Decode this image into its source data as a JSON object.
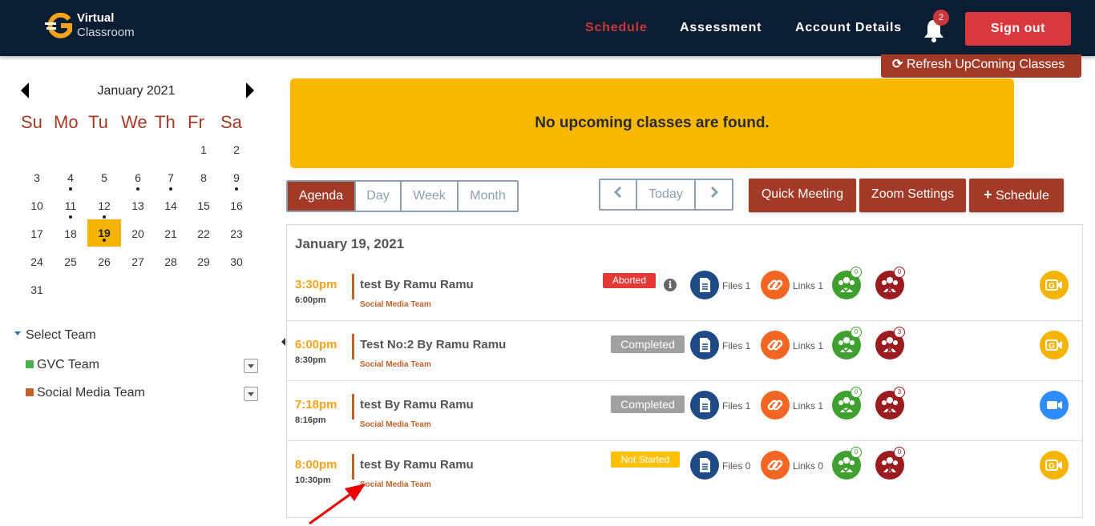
{
  "header": {
    "logo_line1": "Virtual",
    "logo_line2": "Classroom",
    "nav": [
      {
        "label": "Schedule",
        "active": true
      },
      {
        "label": "Assessment",
        "active": false
      },
      {
        "label": "Account Details",
        "active": false
      }
    ],
    "notification_count": "2",
    "signout_label": "Sign out"
  },
  "refresh_label": "Refresh UpComing Classes",
  "calendar": {
    "title": "January 2021",
    "weekdays": [
      "Su",
      "Mo",
      "Tu",
      "We",
      "Th",
      "Fr",
      "Sa"
    ],
    "today": "19",
    "days_with_events": [
      "4",
      "6",
      "7",
      "9",
      "11",
      "12",
      "19"
    ],
    "weeks": [
      [
        "",
        "",
        "",
        "",
        "",
        "1",
        "2"
      ],
      [
        "3",
        "4",
        "5",
        "6",
        "7",
        "8",
        "9"
      ],
      [
        "10",
        "11",
        "12",
        "13",
        "14",
        "15",
        "16"
      ],
      [
        "17",
        "18",
        "19",
        "20",
        "21",
        "22",
        "23"
      ],
      [
        "24",
        "25",
        "26",
        "27",
        "28",
        "29",
        "30"
      ],
      [
        "31",
        "",
        "",
        "",
        "",
        "",
        ""
      ]
    ]
  },
  "teams": {
    "heading": "Select Team",
    "items": [
      {
        "label": "GVC Team",
        "color": "#4caf50"
      },
      {
        "label": "Social Media Team",
        "color": "#c0622a"
      }
    ]
  },
  "banner": "No upcoming classes are found.",
  "view_tabs": [
    "Agenda",
    "Day",
    "Week",
    "Month"
  ],
  "nav_today": "Today",
  "actions": {
    "quick_meeting": "Quick Meeting",
    "zoom_settings": "Zoom Settings",
    "schedule": "Schedule"
  },
  "agenda": {
    "date": "January 19, 2021",
    "events": [
      {
        "start": "3:30pm",
        "end": "6:00pm",
        "title": "test By Ramu Ramu",
        "team": "Social Media Team",
        "status": "Aborted",
        "status_color": "#e53935",
        "files": "Files 1",
        "links": "Links 1",
        "present": "0",
        "absent": "0",
        "join": "gvc"
      },
      {
        "start": "6:00pm",
        "end": "8:30pm",
        "title": "Test No:2 By Ramu Ramu",
        "team": "Social Media Team",
        "status": "Completed",
        "status_color": "#a0a0a0",
        "files": "Files 1",
        "links": "Links 1",
        "present": "0",
        "absent": "3",
        "join": "gvc"
      },
      {
        "start": "7:18pm",
        "end": "8:16pm",
        "title": "test By Ramu Ramu",
        "team": "Social Media Team",
        "status": "Completed",
        "status_color": "#a0a0a0",
        "files": "Files 1",
        "links": "Links 1",
        "present": "0",
        "absent": "3",
        "join": "zoom"
      },
      {
        "start": "8:00pm",
        "end": "10:30pm",
        "title": "test By Ramu Ramu",
        "team": "Social Media Team",
        "status": "Not Started",
        "status_color": "#ffc107",
        "files": "Files 0",
        "links": "Links 0",
        "present": "0",
        "absent": "0",
        "join": "gvc"
      }
    ]
  },
  "colors": {
    "brand": "#a23a27",
    "header_bg": "#0b1d33",
    "banner": "#fbb800",
    "time": "#f5a31a"
  }
}
